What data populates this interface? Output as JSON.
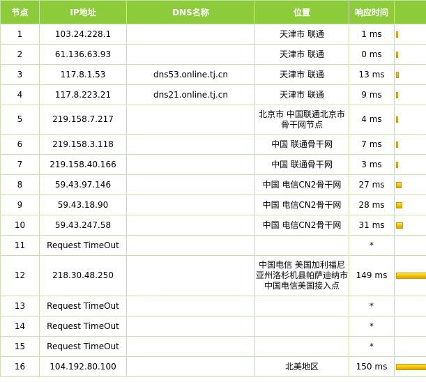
{
  "headers": {
    "hop": "节点",
    "ip": "IP地址",
    "dns": "DNS名称",
    "location": "位置",
    "rtt": "响应时间",
    "bar": ""
  },
  "colors": {
    "header_bg": "#8ccc3a",
    "header_text": "#ffffff",
    "border": "#c9dfae",
    "bar": "#f2c200"
  },
  "max_rtt_ms": 150,
  "rows": [
    {
      "hop": "1",
      "ip": "103.24.228.1",
      "dns": "",
      "location": "天津市 联通",
      "rtt": "1 ms",
      "rtt_ms": 1
    },
    {
      "hop": "2",
      "ip": "61.136.63.93",
      "dns": "",
      "location": "天津市 联通",
      "rtt": "0 ms",
      "rtt_ms": 0
    },
    {
      "hop": "3",
      "ip": "117.8.1.53",
      "dns": "dns53.online.tj.cn",
      "location": "天津市 联通",
      "rtt": "13 ms",
      "rtt_ms": 13
    },
    {
      "hop": "4",
      "ip": "117.8.223.21",
      "dns": "dns21.online.tj.cn",
      "location": "天津市 联通",
      "rtt": "9 ms",
      "rtt_ms": 9
    },
    {
      "hop": "5",
      "ip": "219.158.7.217",
      "dns": "",
      "location": "北京市 中国联通北京市骨干网节点",
      "rtt": "4 ms",
      "rtt_ms": 4
    },
    {
      "hop": "6",
      "ip": "219.158.3.118",
      "dns": "",
      "location": "中国 联通骨干网",
      "rtt": "7 ms",
      "rtt_ms": 7
    },
    {
      "hop": "7",
      "ip": "219.158.40.166",
      "dns": "",
      "location": "中国 联通骨干网",
      "rtt": "3 ms",
      "rtt_ms": 3
    },
    {
      "hop": "8",
      "ip": "59.43.97.146",
      "dns": "",
      "location": "中国 电信CN2骨干网",
      "rtt": "27 ms",
      "rtt_ms": 27
    },
    {
      "hop": "9",
      "ip": "59.43.18.90",
      "dns": "",
      "location": "中国 电信CN2骨干网",
      "rtt": "28 ms",
      "rtt_ms": 28
    },
    {
      "hop": "10",
      "ip": "59.43.247.58",
      "dns": "",
      "location": "中国 电信CN2骨干网",
      "rtt": "31 ms",
      "rtt_ms": 31
    },
    {
      "hop": "11",
      "ip": "Request TimeOut",
      "dns": "",
      "location": "",
      "rtt": "*",
      "rtt_ms": null
    },
    {
      "hop": "12",
      "ip": "218.30.48.250",
      "dns": "",
      "location": "中国电信 美国加利福尼亚州洛杉机县帕萨迪纳市中国电信美国接入点",
      "rtt": "149 ms",
      "rtt_ms": 149
    },
    {
      "hop": "13",
      "ip": "Request TimeOut",
      "dns": "",
      "location": "",
      "rtt": "*",
      "rtt_ms": null
    },
    {
      "hop": "14",
      "ip": "Request TimeOut",
      "dns": "",
      "location": "",
      "rtt": "*",
      "rtt_ms": null
    },
    {
      "hop": "15",
      "ip": "Request TimeOut",
      "dns": "",
      "location": "",
      "rtt": "*",
      "rtt_ms": null
    },
    {
      "hop": "16",
      "ip": "104.192.80.100",
      "dns": "",
      "location": "北美地区",
      "rtt": "150 ms",
      "rtt_ms": 150
    }
  ]
}
